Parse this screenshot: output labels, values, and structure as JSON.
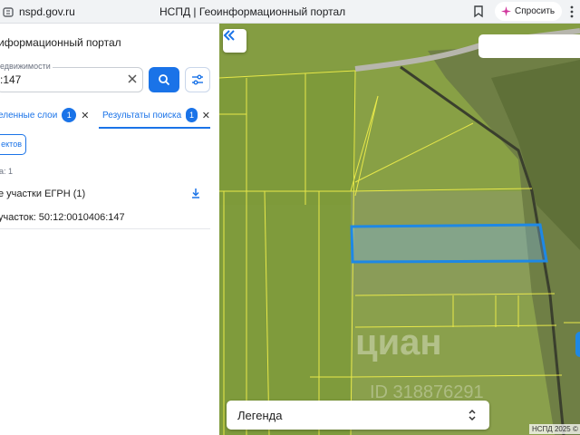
{
  "browser": {
    "url": "nspd.gov.ru",
    "title": "НСПД | Геоинформационный портал",
    "ask_label": "Спросить"
  },
  "panel": {
    "title": "иформационный портал",
    "search": {
      "label": "едвижимости",
      "value": ":147"
    },
    "tabs": {
      "layers_label": "еленные слои",
      "layers_count": "1",
      "results_label": "Результаты поиска",
      "results_count": "1"
    },
    "objects_button_label": "ектов",
    "found_count": "а: 1",
    "group_title": "е участки ЕГРН (1)",
    "result_item": "участок: 50:12:0010406:147"
  },
  "map": {
    "legend_label": "Легенда",
    "copyright": "НСПД 2025 ©"
  },
  "colors": {
    "accent": "#1a73e8",
    "parcel_outline": "#e8e84a",
    "selected_parcel": "#1e88e5"
  }
}
